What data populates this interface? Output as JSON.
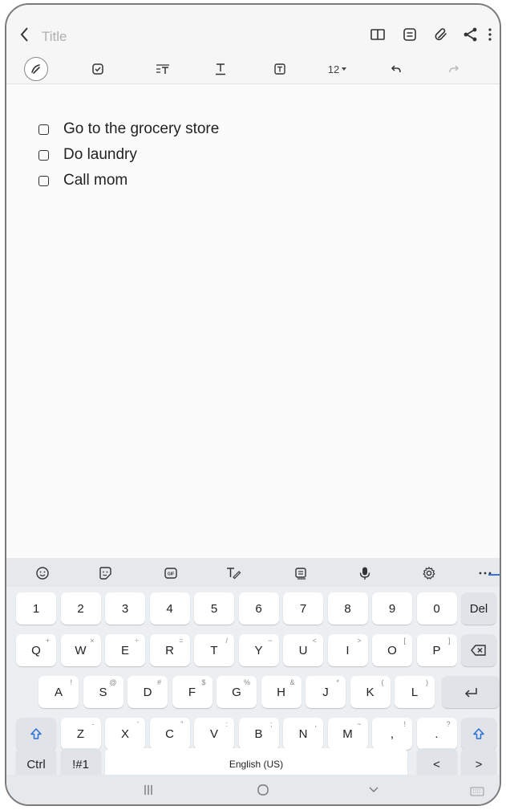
{
  "header": {
    "back_icon": "chevron-left-icon",
    "title_placeholder": "Title",
    "actions": [
      "book-icon",
      "template-icon",
      "attachment-icon",
      "share-icon",
      "more-vertical-icon"
    ]
  },
  "toolbar": {
    "tools": [
      "pen-icon",
      "checkbox-icon",
      "text-style-icon",
      "text-color-icon",
      "text-background-icon"
    ],
    "font_size": "12"
  },
  "note": {
    "checklist": [
      {
        "text": "Go to the grocery store",
        "checked": false
      },
      {
        "text": "Do laundry",
        "checked": false
      },
      {
        "text": "Call mom",
        "checked": false
      }
    ]
  },
  "keyboard": {
    "toolbar_icons": [
      "emoji-icon",
      "sticker-icon",
      "gif-icon",
      "handwriting-icon",
      "clipboard-icon",
      "microphone-icon",
      "settings-icon",
      "more-horizontal-icon"
    ],
    "row_numbers": [
      "1",
      "2",
      "3",
      "4",
      "5",
      "6",
      "7",
      "8",
      "9",
      "0"
    ],
    "del_label": "Del",
    "row_q": [
      {
        "k": "Q",
        "s": "+"
      },
      {
        "k": "W",
        "s": "×"
      },
      {
        "k": "E",
        "s": "÷"
      },
      {
        "k": "R",
        "s": "="
      },
      {
        "k": "T",
        "s": "/"
      },
      {
        "k": "Y",
        "s": "−"
      },
      {
        "k": "U",
        "s": "<"
      },
      {
        "k": "I",
        "s": ">"
      },
      {
        "k": "O",
        "s": "["
      },
      {
        "k": "P",
        "s": "]"
      }
    ],
    "row_a": [
      {
        "k": "A",
        "s": "!"
      },
      {
        "k": "S",
        "s": "@"
      },
      {
        "k": "D",
        "s": "#"
      },
      {
        "k": "F",
        "s": "$"
      },
      {
        "k": "G",
        "s": "%"
      },
      {
        "k": "H",
        "s": "&"
      },
      {
        "k": "J",
        "s": "*"
      },
      {
        "k": "K",
        "s": "("
      },
      {
        "k": "L",
        "s": ")"
      }
    ],
    "row_z": [
      {
        "k": "Z",
        "s": "-"
      },
      {
        "k": "X",
        "s": "'"
      },
      {
        "k": "C",
        "s": "\""
      },
      {
        "k": "V",
        "s": ":"
      },
      {
        "k": "B",
        "s": ";"
      },
      {
        "k": "N",
        "s": ","
      },
      {
        "k": "M",
        "s": "~"
      },
      {
        "k": ",",
        "s": "!"
      },
      {
        "k": ".",
        "s": "?"
      }
    ],
    "ctrl_label": "Ctrl",
    "symbols_label": "!#1",
    "space_label": "English (US)",
    "left_arrow": "<",
    "right_arrow": ">"
  },
  "navbar": {
    "recents_icon": "recents-icon",
    "home_icon": "home-icon",
    "back_icon": "hide-keyboard-icon",
    "keyboard_icon": "keyboard-icon"
  }
}
